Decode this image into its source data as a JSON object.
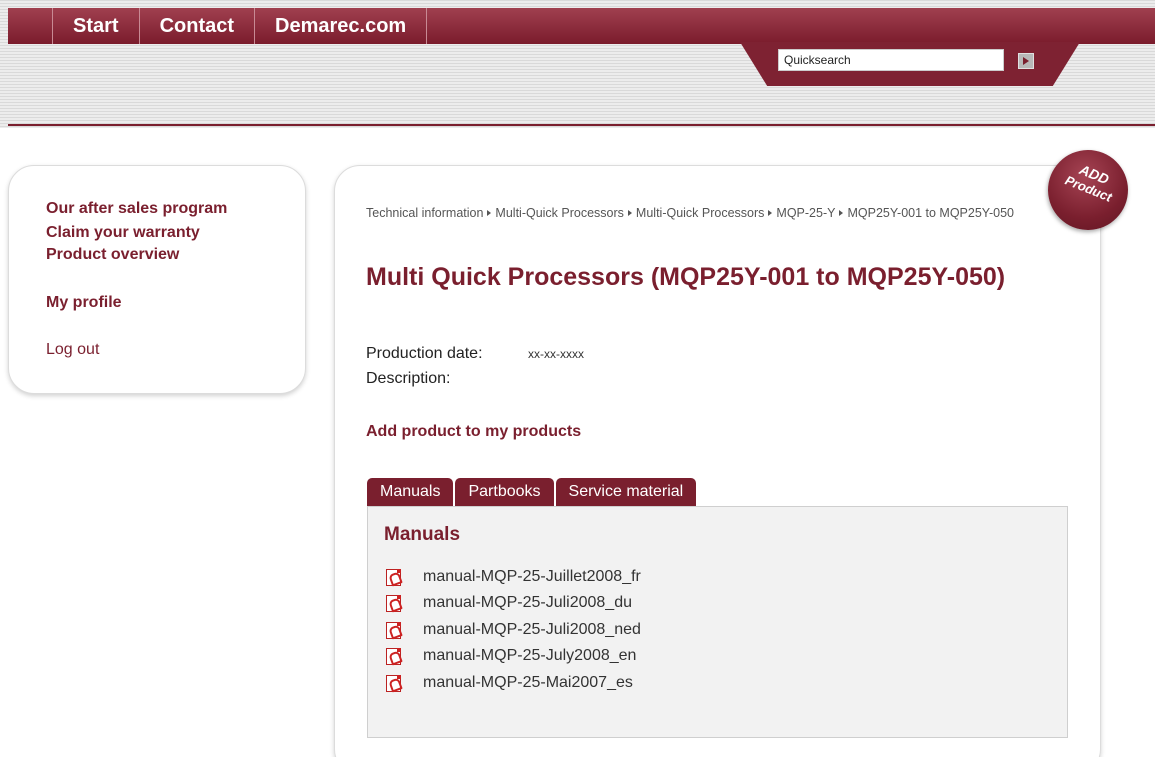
{
  "nav": {
    "tabs": [
      "Start",
      "Contact",
      "Demarec.com"
    ]
  },
  "search": {
    "value": "Quicksearch",
    "button_icon": "play-arrow-icon"
  },
  "sidebar": {
    "items": [
      {
        "label": "Our after sales program"
      },
      {
        "label": "Claim your warranty"
      },
      {
        "label": "Product overview"
      },
      {
        "label": "My profile"
      },
      {
        "label": "Log out"
      }
    ]
  },
  "badge": {
    "line1": "ADD",
    "line2": "Product",
    "color": "#7a1f2e"
  },
  "breadcrumb": {
    "items": [
      "Technical information",
      "Multi-Quick Processors",
      "Multi-Quick Processors",
      "MQP-25-Y",
      "MQP25Y-001 to MQP25Y-050"
    ]
  },
  "product": {
    "title": "Multi Quick Processors (MQP25Y-001 to MQP25Y-050)",
    "production_date_label": "Production date:",
    "production_date_value": "xx-xx-xxxx",
    "description_label": "Description:",
    "add_link": "Add product to my products"
  },
  "tabs": [
    {
      "label": "Manuals"
    },
    {
      "label": "Partbooks"
    },
    {
      "label": "Service material"
    }
  ],
  "panel": {
    "title": "Manuals",
    "files": [
      {
        "name": "manual-MQP-25-Juillet2008_fr",
        "icon": "pdf-icon"
      },
      {
        "name": "manual-MQP-25-Juli2008_du",
        "icon": "pdf-icon"
      },
      {
        "name": "manual-MQP-25-Juli2008_ned",
        "icon": "pdf-icon"
      },
      {
        "name": "manual-MQP-25-July2008_en",
        "icon": "pdf-icon"
      },
      {
        "name": "manual-MQP-25-Mai2007_es",
        "icon": "pdf-icon"
      }
    ]
  },
  "colors": {
    "brand": "#7a1f2e",
    "nav_gradient_top": "#a0404f",
    "panel_bg": "#f2f2f2"
  }
}
